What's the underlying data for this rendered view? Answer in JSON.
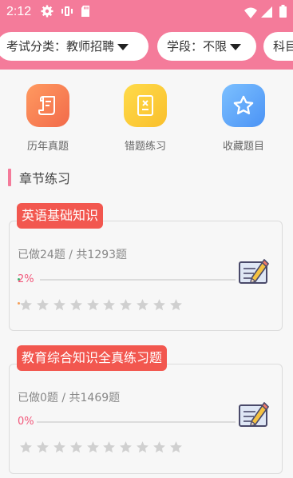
{
  "status_bar": {
    "time": "2:12"
  },
  "filters": [
    {
      "label": "考试分类：教师招聘"
    },
    {
      "label": "学段：不限"
    },
    {
      "label": "科目"
    }
  ],
  "quick_actions": [
    {
      "label": "历年真题",
      "icon": "scroll-icon"
    },
    {
      "label": "错题练习",
      "icon": "wrong-notebook-icon"
    },
    {
      "label": "收藏题目",
      "icon": "star-icon"
    }
  ],
  "section": {
    "title": "章节练习"
  },
  "chapters": [
    {
      "title": "英语基础知识",
      "progress_text": "已做24题 / 共1293题",
      "percent_label": "2%",
      "progress": 0.02,
      "rating": 0,
      "max_rating": 10
    },
    {
      "title": "教育综合知识全真练习题",
      "progress_text": "已做0题 / 共1469题",
      "percent_label": "0%",
      "progress": 0,
      "rating": 0,
      "max_rating": 10
    }
  ],
  "colors": {
    "header": "#f47b9a",
    "badge": "#f2574f",
    "percent": "#f2577a",
    "star_empty": "#d0d0d0"
  }
}
